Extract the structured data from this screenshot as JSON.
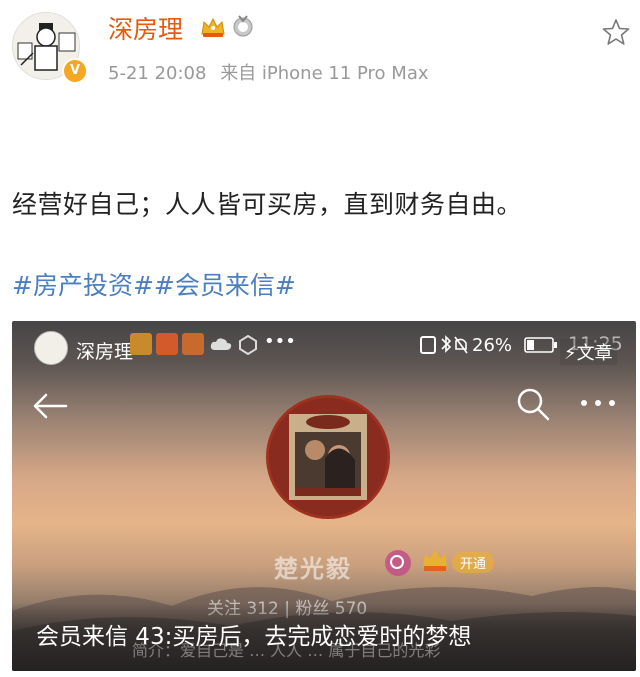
{
  "post": {
    "username": "深房理",
    "verified_badge": "V",
    "date": "5-21 20:08",
    "source": "来自 iPhone 11 Pro Max",
    "text": "经营好自己；人人皆可买房，直到财务自由。",
    "hashtags": [
      "#房产投资#",
      "#会员来信#"
    ]
  },
  "card": {
    "author": "深房理",
    "status_bar": {
      "battery": "26%",
      "time": "11:25"
    },
    "article_label": "文章",
    "profile": {
      "name": "楚光毅",
      "open_label": "开通",
      "stats": "关注  312   |   粉丝  570",
      "bio": "简介：爱自己是 … 人人 … 属于自己的光彩"
    },
    "caption": "会员来信 43:买房后，去完成恋爱时的梦想"
  },
  "icons": {
    "star": "star-icon",
    "crown": "crown-badge-icon",
    "medal": "medal-badge-icon",
    "back": "back-arrow-icon",
    "search": "search-icon",
    "more": "more-icon"
  },
  "colors": {
    "username": "#e8590c",
    "hashtag": "#4a7fc1",
    "meta": "#999999"
  }
}
